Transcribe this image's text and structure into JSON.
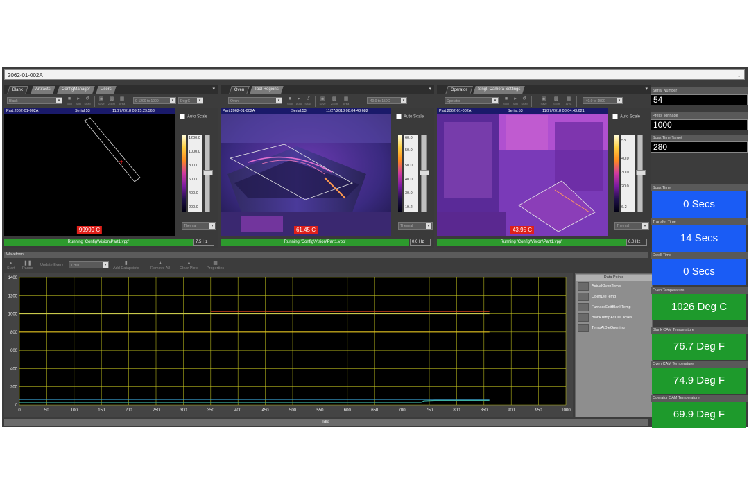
{
  "part_selector": {
    "value": "2062-01-002A"
  },
  "cameras": [
    {
      "tabs": [
        {
          "label": "Blank",
          "active": true
        },
        {
          "label": "Artifacts"
        },
        {
          "label": "ConfigManager"
        },
        {
          "label": "Users"
        }
      ],
      "toolbar": {
        "camera_select": "Blank",
        "buttons": [
          "Start",
          "Stop",
          "Auto",
          "Snap",
          "Save",
          "Zoom",
          "Area",
          "Line"
        ],
        "range_select": "0-1200 to 1000",
        "unit_select": "Deg C"
      },
      "header": {
        "part": "Part:2062-01-002A",
        "serial": "Serial:53",
        "timestamp": "11/27/2018 09:15:29.563"
      },
      "temperature": "99999 C",
      "auto_scale_label": "Auto Scale",
      "scale_ticks": [
        "1200.0",
        "1000.0",
        "800.0",
        "600.0",
        "400.0",
        "200.0"
      ],
      "palette": "Thermal",
      "status": "Running 'Config\\Vision\\Part1.vpp'",
      "rate": "7.5 Hz"
    },
    {
      "tabs": [
        {
          "label": "Oven",
          "active": true
        },
        {
          "label": "Tool Regions"
        }
      ],
      "toolbar": {
        "camera_select": "Oven",
        "buttons": [
          "Start",
          "Stop",
          "Auto",
          "Snap",
          "Save",
          "Zoom",
          "Area",
          "Line"
        ],
        "range_select": "-40.0 to 150C"
      },
      "header": {
        "part": "Part:2062-01-002A",
        "serial": "Serial:53",
        "timestamp": "11/27/2018 08:04:43.682"
      },
      "temperature": "61.45 C",
      "auto_scale_label": "Auto Scale",
      "scale_ticks": [
        "60.0",
        "50.0",
        "50.0",
        "40.0",
        "30.0",
        "19.2"
      ],
      "palette": "Thermal",
      "status": "Running 'Config\\Vision\\Part1.vpp'",
      "rate": "0.0 Hz"
    },
    {
      "tabs": [
        {
          "label": "Operator",
          "active": true
        },
        {
          "label": "Singl. Camera Settings"
        }
      ],
      "toolbar": {
        "camera_select": "Operator",
        "buttons": [
          "Start",
          "Stop",
          "Auto",
          "Snap",
          "Save",
          "Zoom",
          "Area",
          "Line"
        ],
        "range_select": "-40.0 to 150C"
      },
      "header": {
        "part": "Part:2062-01-002A",
        "serial": "Serial:53",
        "timestamp": "11/27/2018 08:04:43.621"
      },
      "temperature": "43.95 C",
      "auto_scale_label": "Auto Scale",
      "scale_ticks": [
        "53.1",
        "40.0",
        "30.0",
        "20.0",
        "6.2"
      ],
      "palette": "Thermal",
      "status": "Running 'Config\\Vision\\Part1.vpp'",
      "rate": "0.0 Hz"
    }
  ],
  "waveform": {
    "title": "Waveform",
    "toolbar": {
      "start": "Start",
      "pause": "Pause",
      "update_every_label": "Update Every",
      "update_every_value": "1 min",
      "add_datapoints": "Add Datapoints",
      "remove_all": "Remove All",
      "clear_plots": "Clear Plots",
      "properties": "Properties"
    },
    "legend_title": "Data Points",
    "status": "Idle"
  },
  "chart_data": {
    "type": "line",
    "xlim": [
      0,
      1000
    ],
    "ylim": [
      0,
      1400
    ],
    "x_ticks": [
      0,
      50,
      100,
      150,
      200,
      250,
      300,
      350,
      400,
      450,
      500,
      550,
      600,
      650,
      700,
      750,
      800,
      850,
      900,
      950,
      1000
    ],
    "y_ticks": [
      0,
      200,
      400,
      600,
      800,
      1000,
      1200,
      1400
    ],
    "grid": true,
    "series": [
      {
        "name": "ActualOvenTemp",
        "color": "#d04020",
        "x": [
          350,
          860
        ],
        "y": [
          1026,
          1026
        ]
      },
      {
        "name": "OpenDieTemp",
        "color": "#c8c84a",
        "x": [
          0,
          860
        ],
        "y": [
          1000,
          1000
        ]
      },
      {
        "name": "FurnaceExitBlankTemp",
        "color": "#e0c020",
        "x": [
          0,
          860
        ],
        "y": [
          800,
          800
        ]
      },
      {
        "name": "BlankTempAsDieCloses",
        "color": "#3cb0a0",
        "x": [
          0,
          735,
          740,
          760,
          860
        ],
        "y": [
          30,
          30,
          45,
          50,
          50
        ]
      },
      {
        "name": "TempAtDieOpening",
        "color": "#3aa0d0",
        "x": [
          0,
          860
        ],
        "y": [
          60,
          60
        ]
      }
    ]
  },
  "right_panel": {
    "serial_number": {
      "label": "Serial Number",
      "value": "54"
    },
    "press_tonnage": {
      "label": "Press Tonnage",
      "value": "1000"
    },
    "soak_time_target": {
      "label": "Soak Time Target",
      "value": "280"
    },
    "soak_time": {
      "label": "Soak Time",
      "value": "0 Secs"
    },
    "transfer_time": {
      "label": "Transfer Time",
      "value": "14 Secs"
    },
    "dwell_time": {
      "label": "Dwell Time",
      "value": "0 Secs"
    },
    "oven_temperature": {
      "label": "Oven Temperature",
      "value": "1026 Deg C"
    },
    "blank_cam_temperature": {
      "label": "Blank CAM Temperature",
      "value": "76.7 Deg F"
    },
    "oven_cam_temperature": {
      "label": "Oven CAM Temperature",
      "value": "74.9 Deg F"
    },
    "operator_cam_temperature": {
      "label": "Operator CAM Temperature",
      "value": "69.9 Deg F"
    }
  },
  "colors": {
    "running": "#2d9a2d",
    "tile_blue": "#1a5cf5",
    "tile_green": "#1e9a2c",
    "temp_badge": "#e0201a"
  }
}
